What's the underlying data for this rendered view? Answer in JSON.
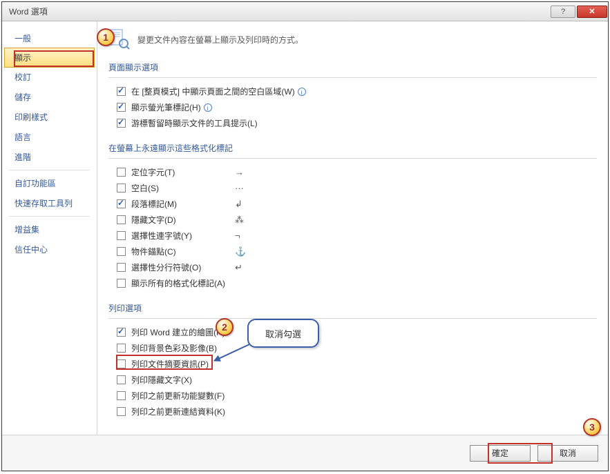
{
  "window": {
    "title": "Word 選項"
  },
  "sidebar": {
    "items": [
      {
        "label": "一般"
      },
      {
        "label": "顯示"
      },
      {
        "label": "校訂"
      },
      {
        "label": "儲存"
      },
      {
        "label": "印刷樣式"
      },
      {
        "label": "語言"
      },
      {
        "label": "進階"
      },
      {
        "label": "自訂功能區"
      },
      {
        "label": "快速存取工具列"
      },
      {
        "label": "增益集"
      },
      {
        "label": "信任中心"
      }
    ]
  },
  "header": {
    "text": "變更文件內容在螢幕上顯示及列印時的方式。"
  },
  "sections": {
    "page_display": {
      "title": "頁面顯示選項",
      "rows": [
        {
          "label": "在 [整頁模式] 中顯示頁面之間的空白區域(W)",
          "checked": true,
          "info": true
        },
        {
          "label": "顯示螢光筆標記(H)",
          "checked": true,
          "info": true
        },
        {
          "label": "游標暫留時顯示文件的工具提示(L)",
          "checked": true,
          "info": false
        }
      ]
    },
    "formatting": {
      "title": "在螢幕上永遠顯示這些格式化標記",
      "rows": [
        {
          "label": "定位字元(T)",
          "sym": "→",
          "checked": false
        },
        {
          "label": "空白(S)",
          "sym": "···",
          "checked": false
        },
        {
          "label": "段落標記(M)",
          "sym": "↲",
          "checked": true
        },
        {
          "label": "隱藏文字(D)",
          "sym": "⁂",
          "checked": false
        },
        {
          "label": "選擇性連字號(Y)",
          "sym": "¬",
          "checked": false
        },
        {
          "label": "物件錨點(C)",
          "sym": "⚓",
          "checked": false
        },
        {
          "label": "選擇性分行符號(O)",
          "sym": "↵",
          "checked": false
        },
        {
          "label": "顯示所有的格式化標記(A)",
          "sym": "",
          "checked": false
        }
      ]
    },
    "print": {
      "title": "列印選項",
      "rows": [
        {
          "label": "列印 Word 建立的繪圖(R)",
          "checked": true
        },
        {
          "label": "列印背景色彩及影像(B)",
          "checked": false
        },
        {
          "label": "列印文件摘要資訊(P)",
          "checked": false
        },
        {
          "label": "列印隱藏文字(X)",
          "checked": false
        },
        {
          "label": "列印之前更新功能變數(F)",
          "checked": false
        },
        {
          "label": "列印之前更新連結資料(K)",
          "checked": false
        }
      ]
    }
  },
  "buttons": {
    "ok": "確定",
    "cancel": "取消"
  },
  "annotations": {
    "n1": "1",
    "n2": "2",
    "n3": "3",
    "callout": "取消勾選"
  }
}
